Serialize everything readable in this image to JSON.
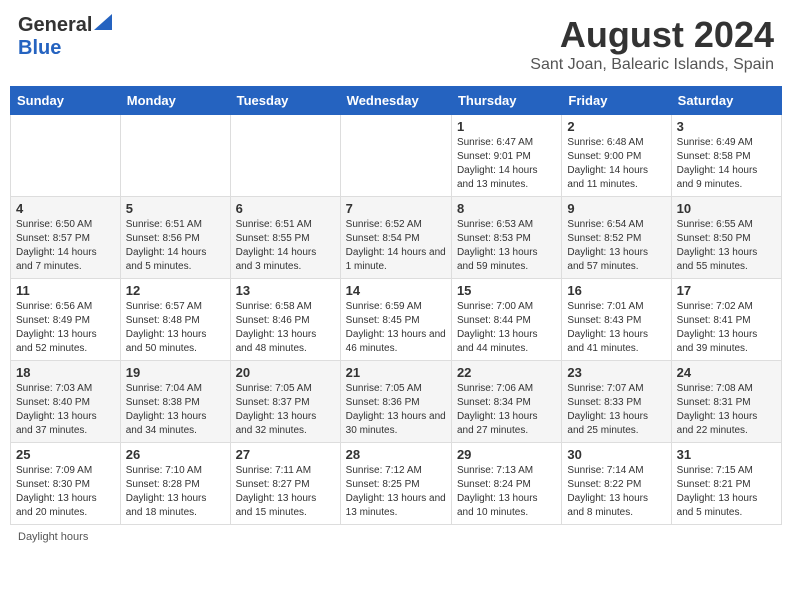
{
  "header": {
    "logo_general": "General",
    "logo_blue": "Blue",
    "title": "August 2024",
    "subtitle": "Sant Joan, Balearic Islands, Spain"
  },
  "columns": [
    "Sunday",
    "Monday",
    "Tuesday",
    "Wednesday",
    "Thursday",
    "Friday",
    "Saturday"
  ],
  "weeks": [
    [
      {
        "day": "",
        "info": ""
      },
      {
        "day": "",
        "info": ""
      },
      {
        "day": "",
        "info": ""
      },
      {
        "day": "",
        "info": ""
      },
      {
        "day": "1",
        "info": "Sunrise: 6:47 AM\nSunset: 9:01 PM\nDaylight: 14 hours and 13 minutes."
      },
      {
        "day": "2",
        "info": "Sunrise: 6:48 AM\nSunset: 9:00 PM\nDaylight: 14 hours and 11 minutes."
      },
      {
        "day": "3",
        "info": "Sunrise: 6:49 AM\nSunset: 8:58 PM\nDaylight: 14 hours and 9 minutes."
      }
    ],
    [
      {
        "day": "4",
        "info": "Sunrise: 6:50 AM\nSunset: 8:57 PM\nDaylight: 14 hours and 7 minutes."
      },
      {
        "day": "5",
        "info": "Sunrise: 6:51 AM\nSunset: 8:56 PM\nDaylight: 14 hours and 5 minutes."
      },
      {
        "day": "6",
        "info": "Sunrise: 6:51 AM\nSunset: 8:55 PM\nDaylight: 14 hours and 3 minutes."
      },
      {
        "day": "7",
        "info": "Sunrise: 6:52 AM\nSunset: 8:54 PM\nDaylight: 14 hours and 1 minute."
      },
      {
        "day": "8",
        "info": "Sunrise: 6:53 AM\nSunset: 8:53 PM\nDaylight: 13 hours and 59 minutes."
      },
      {
        "day": "9",
        "info": "Sunrise: 6:54 AM\nSunset: 8:52 PM\nDaylight: 13 hours and 57 minutes."
      },
      {
        "day": "10",
        "info": "Sunrise: 6:55 AM\nSunset: 8:50 PM\nDaylight: 13 hours and 55 minutes."
      }
    ],
    [
      {
        "day": "11",
        "info": "Sunrise: 6:56 AM\nSunset: 8:49 PM\nDaylight: 13 hours and 52 minutes."
      },
      {
        "day": "12",
        "info": "Sunrise: 6:57 AM\nSunset: 8:48 PM\nDaylight: 13 hours and 50 minutes."
      },
      {
        "day": "13",
        "info": "Sunrise: 6:58 AM\nSunset: 8:46 PM\nDaylight: 13 hours and 48 minutes."
      },
      {
        "day": "14",
        "info": "Sunrise: 6:59 AM\nSunset: 8:45 PM\nDaylight: 13 hours and 46 minutes."
      },
      {
        "day": "15",
        "info": "Sunrise: 7:00 AM\nSunset: 8:44 PM\nDaylight: 13 hours and 44 minutes."
      },
      {
        "day": "16",
        "info": "Sunrise: 7:01 AM\nSunset: 8:43 PM\nDaylight: 13 hours and 41 minutes."
      },
      {
        "day": "17",
        "info": "Sunrise: 7:02 AM\nSunset: 8:41 PM\nDaylight: 13 hours and 39 minutes."
      }
    ],
    [
      {
        "day": "18",
        "info": "Sunrise: 7:03 AM\nSunset: 8:40 PM\nDaylight: 13 hours and 37 minutes."
      },
      {
        "day": "19",
        "info": "Sunrise: 7:04 AM\nSunset: 8:38 PM\nDaylight: 13 hours and 34 minutes."
      },
      {
        "day": "20",
        "info": "Sunrise: 7:05 AM\nSunset: 8:37 PM\nDaylight: 13 hours and 32 minutes."
      },
      {
        "day": "21",
        "info": "Sunrise: 7:05 AM\nSunset: 8:36 PM\nDaylight: 13 hours and 30 minutes."
      },
      {
        "day": "22",
        "info": "Sunrise: 7:06 AM\nSunset: 8:34 PM\nDaylight: 13 hours and 27 minutes."
      },
      {
        "day": "23",
        "info": "Sunrise: 7:07 AM\nSunset: 8:33 PM\nDaylight: 13 hours and 25 minutes."
      },
      {
        "day": "24",
        "info": "Sunrise: 7:08 AM\nSunset: 8:31 PM\nDaylight: 13 hours and 22 minutes."
      }
    ],
    [
      {
        "day": "25",
        "info": "Sunrise: 7:09 AM\nSunset: 8:30 PM\nDaylight: 13 hours and 20 minutes."
      },
      {
        "day": "26",
        "info": "Sunrise: 7:10 AM\nSunset: 8:28 PM\nDaylight: 13 hours and 18 minutes."
      },
      {
        "day": "27",
        "info": "Sunrise: 7:11 AM\nSunset: 8:27 PM\nDaylight: 13 hours and 15 minutes."
      },
      {
        "day": "28",
        "info": "Sunrise: 7:12 AM\nSunset: 8:25 PM\nDaylight: 13 hours and 13 minutes."
      },
      {
        "day": "29",
        "info": "Sunrise: 7:13 AM\nSunset: 8:24 PM\nDaylight: 13 hours and 10 minutes."
      },
      {
        "day": "30",
        "info": "Sunrise: 7:14 AM\nSunset: 8:22 PM\nDaylight: 13 hours and 8 minutes."
      },
      {
        "day": "31",
        "info": "Sunrise: 7:15 AM\nSunset: 8:21 PM\nDaylight: 13 hours and 5 minutes."
      }
    ]
  ],
  "footer": {
    "label": "Daylight hours"
  }
}
